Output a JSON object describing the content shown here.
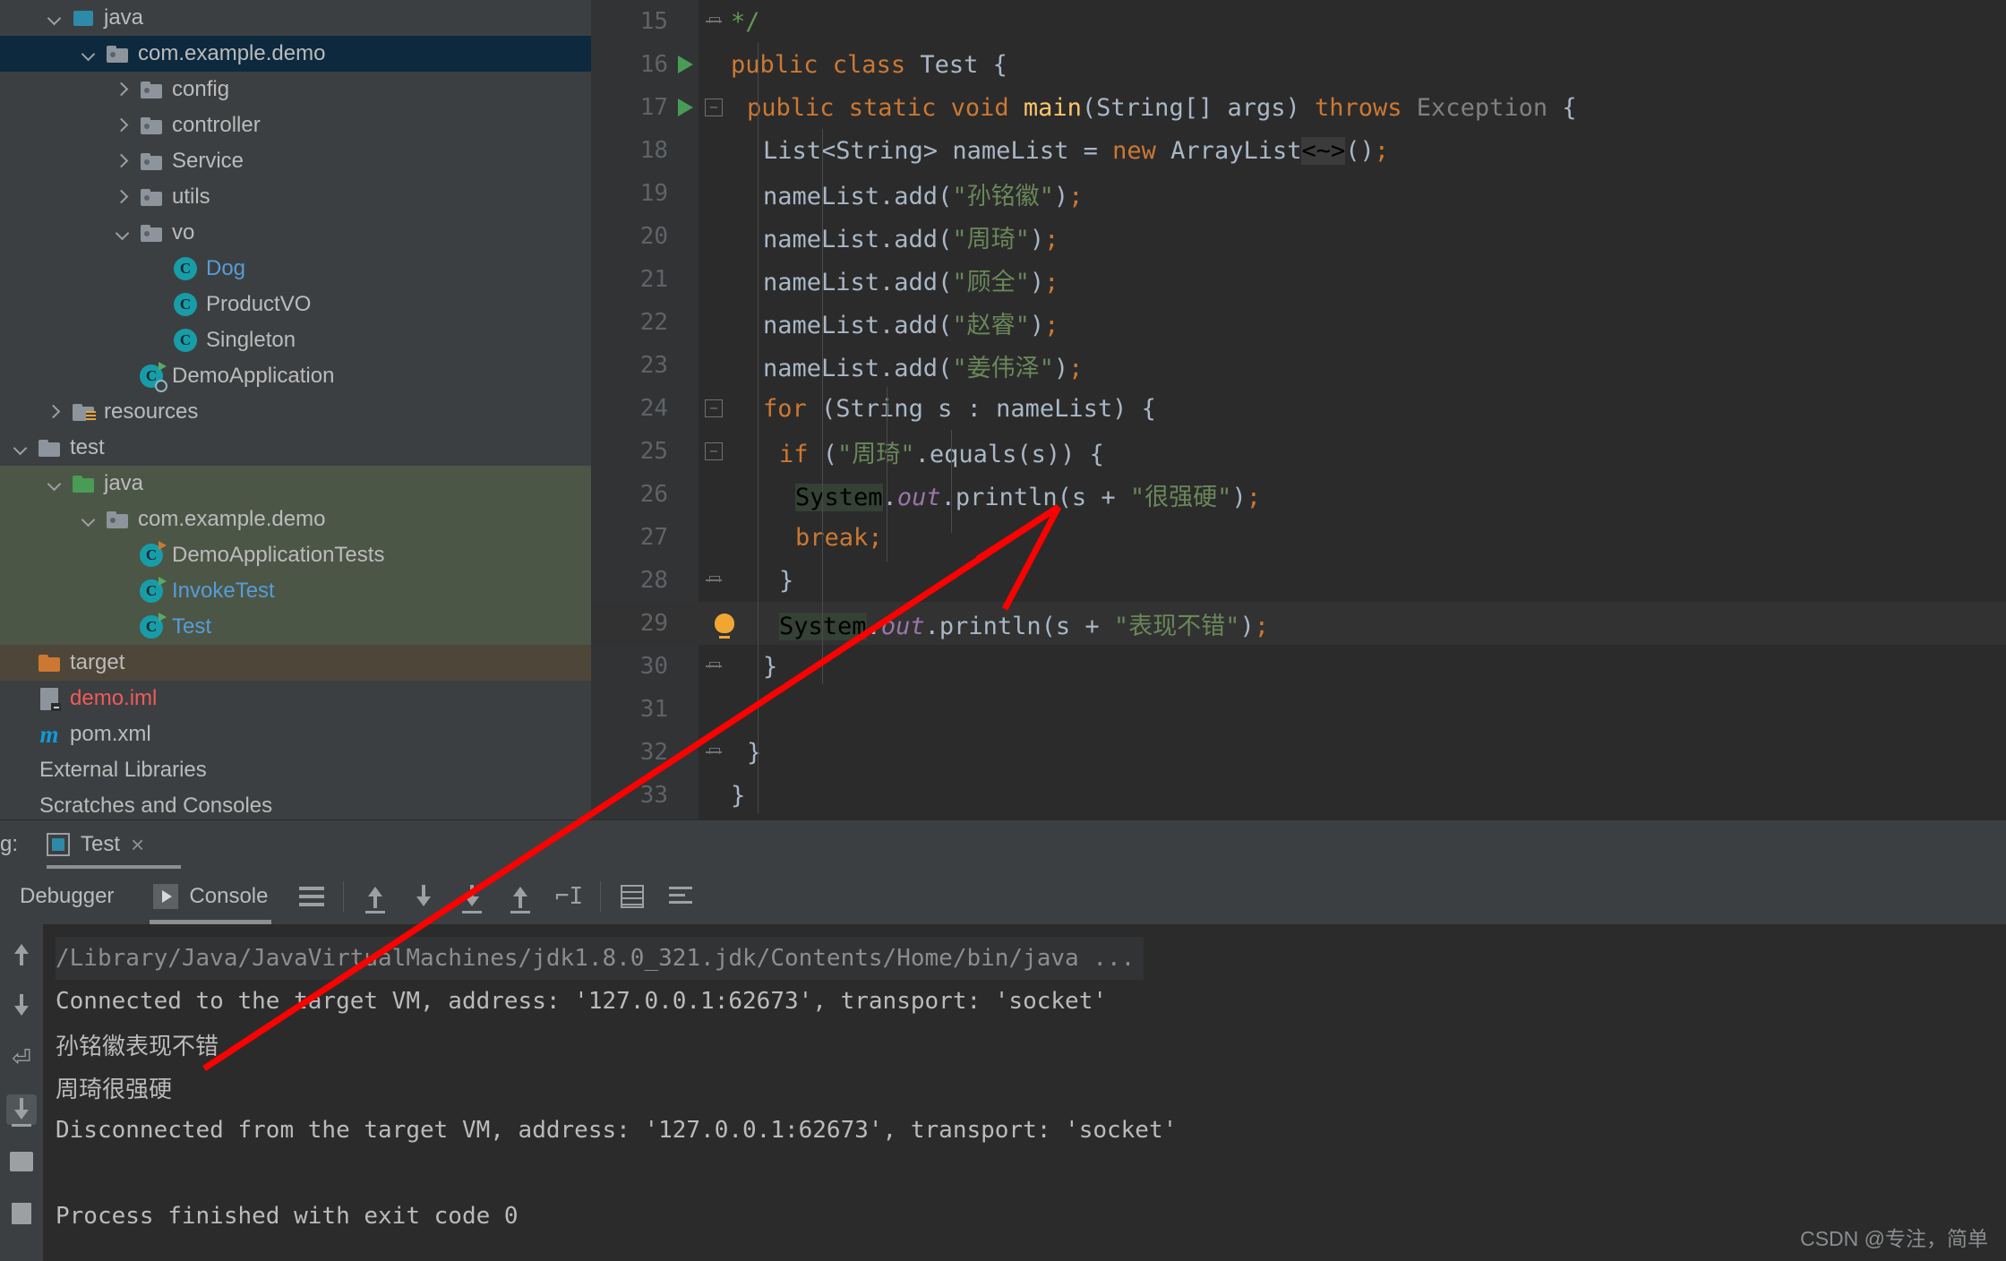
{
  "project_tree": {
    "items": [
      {
        "label": "java",
        "indent": 1,
        "icon": "source-folder-icon",
        "twisty": "down",
        "color": "white",
        "row_bg": "none"
      },
      {
        "label": "com.example.demo",
        "indent": 2,
        "icon": "package-folder-icon",
        "twisty": "down",
        "color": "white",
        "row_bg": "blue"
      },
      {
        "label": "config",
        "indent": 3,
        "icon": "package-folder-icon",
        "twisty": "right",
        "color": "white",
        "row_bg": "none"
      },
      {
        "label": "controller",
        "indent": 3,
        "icon": "package-folder-icon",
        "twisty": "right",
        "color": "white",
        "row_bg": "none"
      },
      {
        "label": "Service",
        "indent": 3,
        "icon": "package-folder-icon",
        "twisty": "right",
        "color": "white",
        "row_bg": "none"
      },
      {
        "label": "utils",
        "indent": 3,
        "icon": "package-folder-icon",
        "twisty": "right",
        "color": "white",
        "row_bg": "none"
      },
      {
        "label": "vo",
        "indent": 3,
        "icon": "package-folder-icon",
        "twisty": "down",
        "color": "white",
        "row_bg": "none"
      },
      {
        "label": "Dog",
        "indent": 4,
        "icon": "java-class-icon",
        "twisty": "none",
        "color": "blue",
        "row_bg": "none"
      },
      {
        "label": "ProductVO",
        "indent": 4,
        "icon": "java-class-icon",
        "twisty": "none",
        "color": "white",
        "row_bg": "none"
      },
      {
        "label": "Singleton",
        "indent": 4,
        "icon": "java-class-icon",
        "twisty": "none",
        "color": "white",
        "row_bg": "none"
      },
      {
        "label": "DemoApplication",
        "indent": 3,
        "icon": "spring-boot-class-icon",
        "twisty": "none",
        "color": "white",
        "row_bg": "none"
      },
      {
        "label": "resources",
        "indent": 1,
        "icon": "resources-folder-icon",
        "twisty": "right",
        "color": "white",
        "row_bg": "none"
      },
      {
        "label": "test",
        "indent": 0,
        "icon": "folder-icon",
        "twisty": "down",
        "color": "white",
        "row_bg": "none"
      },
      {
        "label": "java",
        "indent": 1,
        "icon": "test-source-folder-icon",
        "twisty": "down",
        "color": "white",
        "row_bg": "green"
      },
      {
        "label": "com.example.demo",
        "indent": 2,
        "icon": "package-folder-icon",
        "twisty": "down",
        "color": "white",
        "row_bg": "green"
      },
      {
        "label": "DemoApplicationTests",
        "indent": 3,
        "icon": "test-class-icon",
        "twisty": "none",
        "color": "white",
        "row_bg": "green"
      },
      {
        "label": "InvokeTest",
        "indent": 3,
        "icon": "runnable-class-icon",
        "twisty": "none",
        "color": "blue",
        "row_bg": "green"
      },
      {
        "label": "Test",
        "indent": 3,
        "icon": "runnable-class-icon",
        "twisty": "none",
        "color": "blue",
        "row_bg": "green"
      },
      {
        "label": "target",
        "indent": 0,
        "icon": "excluded-folder-icon",
        "twisty": "none",
        "color": "white",
        "row_bg": "brown"
      },
      {
        "label": "demo.iml",
        "indent": 0,
        "icon": "iml-file-icon",
        "twisty": "none",
        "color": "red",
        "row_bg": "none"
      },
      {
        "label": "pom.xml",
        "indent": 0,
        "icon": "maven-file-icon",
        "twisty": "none",
        "color": "white",
        "row_bg": "none"
      },
      {
        "label": "External Libraries",
        "indent": 0,
        "icon": "none",
        "twisty": "none",
        "color": "white",
        "row_bg": "none"
      },
      {
        "label": "Scratches and Consoles",
        "indent": 0,
        "icon": "none",
        "twisty": "none",
        "color": "white",
        "row_bg": "none"
      }
    ]
  },
  "editor": {
    "lines": [
      {
        "no": "15",
        "gutter": "fold-end",
        "indent": 0,
        "current": false,
        "tokens": [
          {
            "t": "*/",
            "c": "cmt"
          }
        ]
      },
      {
        "no": "16",
        "gutter": "run",
        "indent": 0,
        "current": false,
        "tokens": [
          {
            "t": "public ",
            "c": "kw"
          },
          {
            "t": "class ",
            "c": "kw"
          },
          {
            "t": "Test ",
            "c": "txt"
          },
          {
            "t": "{",
            "c": "txt"
          }
        ]
      },
      {
        "no": "17",
        "gutter": "run-fold",
        "indent": 1,
        "current": false,
        "tokens": [
          {
            "t": "public ",
            "c": "kw"
          },
          {
            "t": "static ",
            "c": "kw"
          },
          {
            "t": "void ",
            "c": "kw"
          },
          {
            "t": "main",
            "c": "fn"
          },
          {
            "t": "(String[] args) ",
            "c": "txt"
          },
          {
            "t": "throws ",
            "c": "kw"
          },
          {
            "t": "Exception",
            "c": "gry"
          },
          {
            "t": " {",
            "c": "txt"
          }
        ]
      },
      {
        "no": "18",
        "gutter": "none",
        "indent": 2,
        "current": false,
        "tokens": [
          {
            "t": "List<String> nameList = ",
            "c": "txt"
          },
          {
            "t": "new ",
            "c": "kw"
          },
          {
            "t": "ArrayList",
            "c": "txt"
          },
          {
            "t": "<~>",
            "c": "hl-gray"
          },
          {
            "t": "()",
            "c": "txt"
          },
          {
            "t": ";",
            "c": "semi"
          }
        ]
      },
      {
        "no": "19",
        "gutter": "none",
        "indent": 2,
        "current": false,
        "tokens": [
          {
            "t": "nameList.add(",
            "c": "txt"
          },
          {
            "t": "\"孙铭徽\"",
            "c": "str"
          },
          {
            "t": ")",
            "c": "txt"
          },
          {
            "t": ";",
            "c": "semi"
          }
        ]
      },
      {
        "no": "20",
        "gutter": "none",
        "indent": 2,
        "current": false,
        "tokens": [
          {
            "t": "nameList.add(",
            "c": "txt"
          },
          {
            "t": "\"周琦\"",
            "c": "str"
          },
          {
            "t": ")",
            "c": "txt"
          },
          {
            "t": ";",
            "c": "semi"
          }
        ]
      },
      {
        "no": "21",
        "gutter": "none",
        "indent": 2,
        "current": false,
        "tokens": [
          {
            "t": "nameList.add(",
            "c": "txt"
          },
          {
            "t": "\"顾全\"",
            "c": "str"
          },
          {
            "t": ")",
            "c": "txt"
          },
          {
            "t": ";",
            "c": "semi"
          }
        ]
      },
      {
        "no": "22",
        "gutter": "none",
        "indent": 2,
        "current": false,
        "tokens": [
          {
            "t": "nameList.add(",
            "c": "txt"
          },
          {
            "t": "\"赵睿\"",
            "c": "str"
          },
          {
            "t": ")",
            "c": "txt"
          },
          {
            "t": ";",
            "c": "semi"
          }
        ]
      },
      {
        "no": "23",
        "gutter": "none",
        "indent": 2,
        "current": false,
        "tokens": [
          {
            "t": "nameList.add(",
            "c": "txt"
          },
          {
            "t": "\"姜伟泽\"",
            "c": "str"
          },
          {
            "t": ")",
            "c": "txt"
          },
          {
            "t": ";",
            "c": "semi"
          }
        ]
      },
      {
        "no": "24",
        "gutter": "fold",
        "indent": 2,
        "current": false,
        "tokens": [
          {
            "t": "for ",
            "c": "kw"
          },
          {
            "t": "(String s : nameList) {",
            "c": "txt"
          }
        ]
      },
      {
        "no": "25",
        "gutter": "fold",
        "indent": 3,
        "current": false,
        "tokens": [
          {
            "t": "if ",
            "c": "kw"
          },
          {
            "t": "(",
            "c": "txt"
          },
          {
            "t": "\"周琦\"",
            "c": "str"
          },
          {
            "t": ".equals(s)) {",
            "c": "txt"
          }
        ]
      },
      {
        "no": "26",
        "gutter": "none",
        "indent": 4,
        "current": false,
        "tokens": [
          {
            "t": "System",
            "c": "hl-green"
          },
          {
            "t": ".",
            "c": "txt"
          },
          {
            "t": "out",
            "c": "fld"
          },
          {
            "t": ".println(s + ",
            "c": "txt"
          },
          {
            "t": "\"很强硬\"",
            "c": "str"
          },
          {
            "t": ")",
            "c": "txt"
          },
          {
            "t": ";",
            "c": "semi"
          }
        ]
      },
      {
        "no": "27",
        "gutter": "none",
        "indent": 4,
        "current": false,
        "tokens": [
          {
            "t": "break",
            "c": "kw"
          },
          {
            "t": ";",
            "c": "semi"
          }
        ]
      },
      {
        "no": "28",
        "gutter": "fold-end",
        "indent": 3,
        "current": false,
        "tokens": [
          {
            "t": "}",
            "c": "txt"
          }
        ]
      },
      {
        "no": "29",
        "gutter": "bulb",
        "indent": 3,
        "current": true,
        "tokens": [
          {
            "t": "System",
            "c": "hl-green"
          },
          {
            "t": ".",
            "c": "txt"
          },
          {
            "t": "out",
            "c": "fld"
          },
          {
            "t": ".println(s + ",
            "c": "txt"
          },
          {
            "t": "\"表现不错\"",
            "c": "str"
          },
          {
            "t": ")",
            "c": "txt"
          },
          {
            "t": ";",
            "c": "semi"
          }
        ]
      },
      {
        "no": "30",
        "gutter": "fold-end",
        "indent": 2,
        "current": false,
        "tokens": [
          {
            "t": "}",
            "c": "txt"
          }
        ]
      },
      {
        "no": "31",
        "gutter": "none",
        "indent": 0,
        "current": false,
        "tokens": []
      },
      {
        "no": "32",
        "gutter": "fold-end",
        "indent": 1,
        "current": false,
        "tokens": [
          {
            "t": "}",
            "c": "txt"
          }
        ]
      },
      {
        "no": "33",
        "gutter": "none",
        "indent": 0,
        "current": false,
        "tokens": [
          {
            "t": "}",
            "c": "txt"
          }
        ]
      }
    ]
  },
  "run_panel": {
    "prefix_label": "g:",
    "tab_name": "Test",
    "close_label": "×",
    "tool_tabs": [
      {
        "label": "Debugger",
        "active": false,
        "icon": "none"
      },
      {
        "label": "Console",
        "active": true,
        "icon": "console-play-icon"
      }
    ],
    "toolbar_icons": [
      "soft-wrap-icon",
      "scroll-up-icon",
      "scroll-down-icon",
      "scroll-to-end-icon",
      "scroll-to-start-icon",
      "go-to-cursor-icon",
      "print-icon",
      "clear-all-icon"
    ],
    "side_icons": [
      "scroll-up-icon",
      "scroll-down-icon",
      "soft-wrap-icon",
      "scroll-to-end-icon",
      "print-icon",
      "clear-all-icon"
    ]
  },
  "console": {
    "lines": [
      {
        "text": "/Library/Java/JavaVirtualMachines/jdk1.8.0_321.jdk/Contents/Home/bin/java ...",
        "style": "path"
      },
      {
        "text": "Connected to the target VM, address: '127.0.0.1:62673', transport: 'socket'",
        "style": "normal"
      },
      {
        "text": "孙铭徽表现不错",
        "style": "normal"
      },
      {
        "text": "周琦很强硬",
        "style": "normal"
      },
      {
        "text": "Disconnected from the target VM, address: '127.0.0.1:62673', transport: 'socket'",
        "style": "normal"
      },
      {
        "text": "",
        "style": "normal"
      },
      {
        "text": "Process finished with exit code 0",
        "style": "normal"
      }
    ]
  },
  "watermark": {
    "text": "CSDN @专注，简单"
  },
  "colors": {
    "editor_bg": "#2b2b2b",
    "panel_bg": "#3c3f41",
    "selection_blue": "#0d293e",
    "test_root_green": "#4c5647",
    "excluded_brown": "#4e4639",
    "keyword_orange": "#cc7832",
    "string_green": "#6a8759",
    "method_yellow": "#ffc66d",
    "field_purple": "#9876aa",
    "annotation_red": "#ff0000"
  }
}
